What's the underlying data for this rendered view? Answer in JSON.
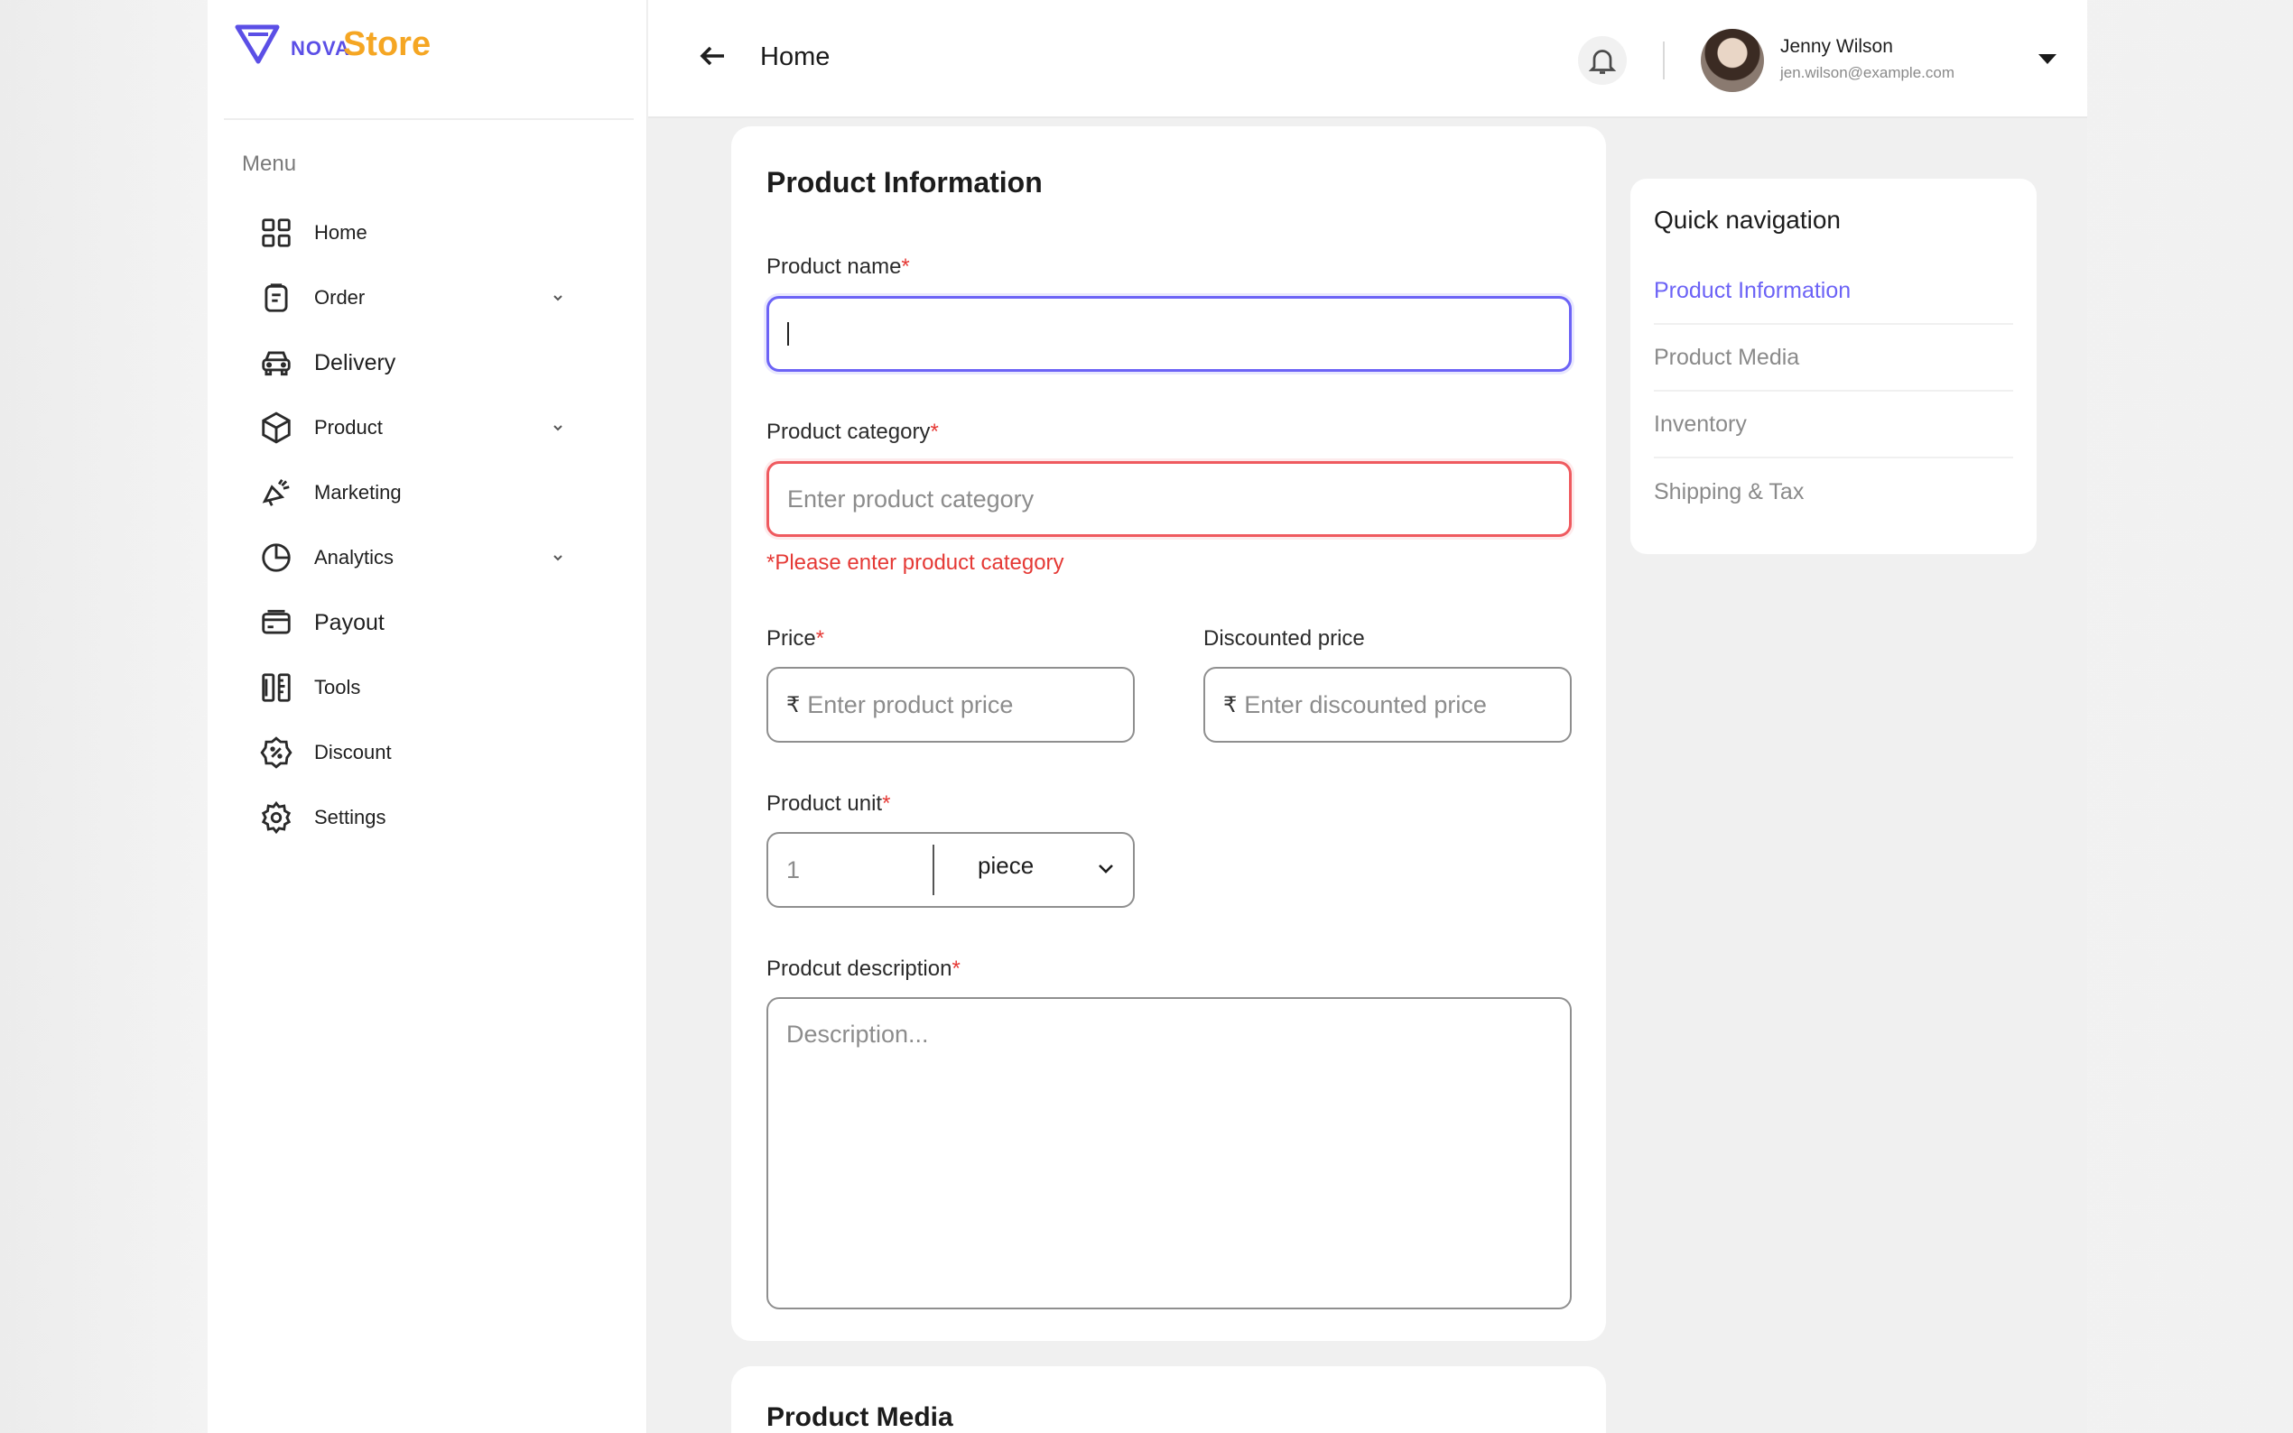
{
  "brand": {
    "prefix": "NOVA",
    "name": "Store"
  },
  "sidebar": {
    "menu_label": "Menu",
    "items": [
      {
        "label": "Home",
        "icon": "grid-icon",
        "has_children": false
      },
      {
        "label": "Order",
        "icon": "clipboard-icon",
        "has_children": true
      },
      {
        "label": "Delivery",
        "icon": "car-icon",
        "has_children": false
      },
      {
        "label": "Product",
        "icon": "box-icon",
        "has_children": true
      },
      {
        "label": "Marketing",
        "icon": "megaphone-icon",
        "has_children": false
      },
      {
        "label": "Analytics",
        "icon": "pie-chart-icon",
        "has_children": true
      },
      {
        "label": "Payout",
        "icon": "wallet-icon",
        "has_children": false
      },
      {
        "label": "Tools",
        "icon": "ruler-icon",
        "has_children": false
      },
      {
        "label": "Discount",
        "icon": "discount-badge-icon",
        "has_children": false
      },
      {
        "label": "Settings",
        "icon": "gear-icon",
        "has_children": false
      }
    ]
  },
  "header": {
    "title": "Home",
    "user": {
      "name": "Jenny Wilson",
      "email": "jen.wilson@example.com"
    }
  },
  "form": {
    "section_title": "Product Information",
    "required_mark": "*",
    "product_name": {
      "label": "Product name",
      "value": ""
    },
    "product_category": {
      "label": "Product category",
      "placeholder": "Enter product category",
      "error": "*Please enter product category"
    },
    "price": {
      "label": "Price",
      "currency": "₹",
      "placeholder": "Enter product price"
    },
    "discounted_price": {
      "label": "Discounted price",
      "currency": "₹",
      "placeholder": "Enter discounted price"
    },
    "product_unit": {
      "label": "Product unit",
      "quantity_placeholder": "1",
      "unit": "piece"
    },
    "description": {
      "label": "Prodcut description",
      "placeholder": "Description..."
    }
  },
  "next_section_title": "Product Media",
  "quick_nav": {
    "title": "Quick navigation",
    "items": [
      {
        "label": "Product Information",
        "active": true
      },
      {
        "label": "Product Media",
        "active": false
      },
      {
        "label": "Inventory",
        "active": false
      },
      {
        "label": "Shipping  & Tax",
        "active": false
      }
    ]
  },
  "colors": {
    "accent": "#6c63f6",
    "brand_orange": "#f5a623",
    "error": "#e53935"
  }
}
